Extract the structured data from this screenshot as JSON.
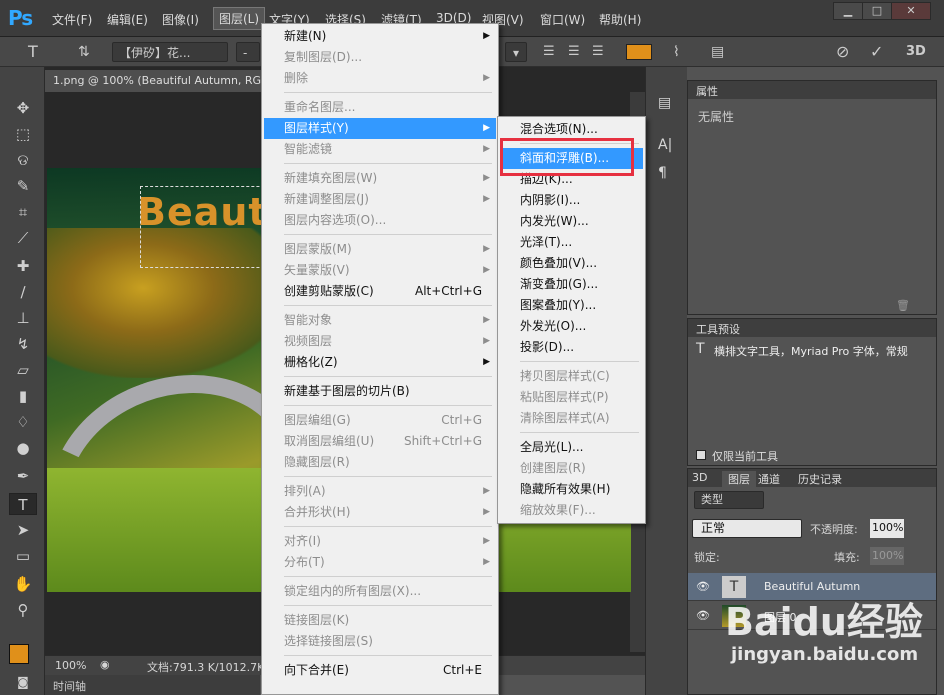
{
  "app": {
    "logo": "Ps"
  },
  "menubar": {
    "items": [
      "文件(F)",
      "编辑(E)",
      "图像(I)",
      "图层(L)",
      "文字(Y)",
      "选择(S)",
      "滤镜(T)",
      "3D(D)",
      "视图(V)",
      "窗口(W)",
      "帮助(H)"
    ]
  },
  "window_controls": {
    "minimize": "▁",
    "restore": "□",
    "close": "✕"
  },
  "options": {
    "tool_glyph": "T",
    "font_family": "【伊矽】花...",
    "font_style": "-",
    "swatch_color": "#e0901a",
    "btn_3d": "3D"
  },
  "document": {
    "tab_title": "1.png @ 100% (Beautiful Autumn, RGB",
    "canvas_text": "Beaut",
    "zoom": "100%",
    "doc_size": "文档:791.3 K/1012.7K",
    "timeline_label": "时间轴"
  },
  "properties": {
    "tab": "属性",
    "empty_label": "无属性"
  },
  "tool_presets": {
    "tab": "工具预设",
    "item": "横排文字工具，Myriad Pro 字体，常规",
    "current_only_label": "仅限当前工具"
  },
  "layers_panel": {
    "tabs": [
      "3D",
      "图层",
      "通道",
      "历史记录"
    ],
    "kind_filter": "类型",
    "blend_mode": "正常",
    "opacity_label": "不透明度:",
    "opacity_value": "100%",
    "lock_label": "锁定:",
    "fill_label": "填充:",
    "fill_value": "100%",
    "layers": [
      {
        "name": "Beautiful Autumn",
        "thumb": "T"
      },
      {
        "name": "图层 0",
        "thumb": ""
      }
    ]
  },
  "layer_menu": [
    {
      "label": "新建(N)",
      "shortcut": "",
      "arrow": true,
      "disabled": false
    },
    {
      "label": "复制图层(D)...",
      "shortcut": "",
      "arrow": false,
      "disabled": true
    },
    {
      "label": "删除",
      "shortcut": "",
      "arrow": true,
      "disabled": true
    },
    {
      "sep": true
    },
    {
      "label": "重命名图层...",
      "shortcut": "",
      "arrow": false,
      "disabled": true
    },
    {
      "label": "图层样式(Y)",
      "shortcut": "",
      "arrow": true,
      "disabled": false,
      "highlight": true
    },
    {
      "label": "智能滤镜",
      "shortcut": "",
      "arrow": true,
      "disabled": true
    },
    {
      "sep": true
    },
    {
      "label": "新建填充图层(W)",
      "shortcut": "",
      "arrow": true,
      "disabled": true
    },
    {
      "label": "新建调整图层(J)",
      "shortcut": "",
      "arrow": true,
      "disabled": true
    },
    {
      "label": "图层内容选项(O)...",
      "shortcut": "",
      "arrow": false,
      "disabled": true
    },
    {
      "sep": true
    },
    {
      "label": "图层蒙版(M)",
      "shortcut": "",
      "arrow": true,
      "disabled": true
    },
    {
      "label": "矢量蒙版(V)",
      "shortcut": "",
      "arrow": true,
      "disabled": true
    },
    {
      "label": "创建剪贴蒙版(C)",
      "shortcut": "Alt+Ctrl+G",
      "arrow": false,
      "disabled": false
    },
    {
      "sep": true
    },
    {
      "label": "智能对象",
      "shortcut": "",
      "arrow": true,
      "disabled": true
    },
    {
      "label": "视频图层",
      "shortcut": "",
      "arrow": true,
      "disabled": true
    },
    {
      "label": "栅格化(Z)",
      "shortcut": "",
      "arrow": true,
      "disabled": false
    },
    {
      "sep": true
    },
    {
      "label": "新建基于图层的切片(B)",
      "shortcut": "",
      "arrow": false,
      "disabled": false
    },
    {
      "sep": true
    },
    {
      "label": "图层编组(G)",
      "shortcut": "Ctrl+G",
      "arrow": false,
      "disabled": true
    },
    {
      "label": "取消图层编组(U)",
      "shortcut": "Shift+Ctrl+G",
      "arrow": false,
      "disabled": true
    },
    {
      "label": "隐藏图层(R)",
      "shortcut": "",
      "arrow": false,
      "disabled": true
    },
    {
      "sep": true
    },
    {
      "label": "排列(A)",
      "shortcut": "",
      "arrow": true,
      "disabled": true
    },
    {
      "label": "合并形状(H)",
      "shortcut": "",
      "arrow": true,
      "disabled": true
    },
    {
      "sep": true
    },
    {
      "label": "对齐(I)",
      "shortcut": "",
      "arrow": true,
      "disabled": true
    },
    {
      "label": "分布(T)",
      "shortcut": "",
      "arrow": true,
      "disabled": true
    },
    {
      "sep": true
    },
    {
      "label": "锁定组内的所有图层(X)...",
      "shortcut": "",
      "arrow": false,
      "disabled": true
    },
    {
      "sep": true
    },
    {
      "label": "链接图层(K)",
      "shortcut": "",
      "arrow": false,
      "disabled": true
    },
    {
      "label": "选择链接图层(S)",
      "shortcut": "",
      "arrow": false,
      "disabled": true
    },
    {
      "sep": true
    },
    {
      "label": "向下合并(E)",
      "shortcut": "Ctrl+E",
      "arrow": false,
      "disabled": false
    }
  ],
  "style_menu": [
    {
      "label": "混合选项(N)...",
      "disabled": false
    },
    {
      "sep": true
    },
    {
      "label": "斜面和浮雕(B)...",
      "disabled": false,
      "highlight": true
    },
    {
      "label": "描边(K)...",
      "disabled": false
    },
    {
      "label": "内阴影(I)...",
      "disabled": false
    },
    {
      "label": "内发光(W)...",
      "disabled": false
    },
    {
      "label": "光泽(T)...",
      "disabled": false
    },
    {
      "label": "颜色叠加(V)...",
      "disabled": false
    },
    {
      "label": "渐变叠加(G)...",
      "disabled": false
    },
    {
      "label": "图案叠加(Y)...",
      "disabled": false
    },
    {
      "label": "外发光(O)...",
      "disabled": false
    },
    {
      "label": "投影(D)...",
      "disabled": false
    },
    {
      "sep": true
    },
    {
      "label": "拷贝图层样式(C)",
      "disabled": true
    },
    {
      "label": "粘贴图层样式(P)",
      "disabled": true
    },
    {
      "label": "清除图层样式(A)",
      "disabled": true
    },
    {
      "sep": true
    },
    {
      "label": "全局光(L)...",
      "disabled": false
    },
    {
      "label": "创建图层(R)",
      "disabled": true
    },
    {
      "label": "隐藏所有效果(H)",
      "disabled": false
    },
    {
      "label": "缩放效果(F)...",
      "disabled": true
    }
  ],
  "watermark": {
    "brand": "Baidu经验",
    "url": "jingyan.baidu.com"
  },
  "colors": {
    "highlight": "#3399ff",
    "annotation": "#e63040",
    "foreground": "#e0901a",
    "background": "#ffffff"
  }
}
